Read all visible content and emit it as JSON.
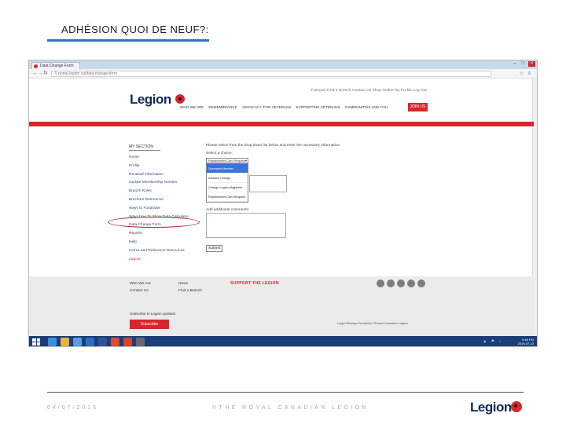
{
  "slide": {
    "title": "ADHÉSION QUOI DE NEUF?:",
    "footer_date": "04/07/2016",
    "footer_copyright": "©THE ROYAL CANADIAN LEGION",
    "footer_logo": "Legion"
  },
  "browser": {
    "tab_title": "Data Change Form",
    "url": "© portal.legion.ca/data-change-form",
    "window_controls": [
      "minimize-icon",
      "maximize-icon",
      "close-icon"
    ]
  },
  "site": {
    "utility_links": "Français   Find a Branch   Contact Us   Shop Online   My Profile   Log Out",
    "logo": "Legion",
    "nav": [
      "WHO WE ARE",
      "REMEMBRANCE",
      "ADVOCACY FOR VETERANS",
      "SUPPORTING VETERANS",
      "COMMUNITIES AND YOU"
    ],
    "join_label": "JOIN US",
    "sidebar": {
      "title": "MY SECTION",
      "items": [
        "Home",
        "Profile",
        "Renewal Information",
        "Update Membership Number",
        "Branch Roles",
        "Brochure Resources",
        "Ways to Fundraise",
        "Ways how To Show Data Calculator",
        "Data Change Form",
        "Reports",
        "Help",
        "Forms and Reference Resources",
        "Logout"
      ]
    },
    "form": {
      "intro": "Please select from the drop down list below and enter the necessary information.",
      "select_label": "Select a choice:",
      "select_value": "Replacement Card Request",
      "options": [
        "Deceased Member",
        "Address Change",
        "Change Legion Magazine",
        "Replacement Card Request"
      ],
      "selected_index": 0,
      "comments_label": "Add additional comments:",
      "submit_label": "Submit"
    },
    "footer": {
      "col1": [
        "Who We Are",
        "Contact Us"
      ],
      "col2": [
        "News",
        "Find a Branch"
      ],
      "support": "SUPPORT THE LEGION",
      "social_icons": [
        "youtube-icon",
        "facebook-icon",
        "twitter-icon",
        "instagram-icon",
        "email-icon"
      ],
      "newsletter": "Subscribe to Legion updates",
      "subscribe_label": "Subscribe",
      "legal": "Legal   Sitemap   Feedback   ©Royal Canadian Legion"
    }
  },
  "taskbar": {
    "time": "9:46 PM",
    "date": "2016-07-13"
  }
}
